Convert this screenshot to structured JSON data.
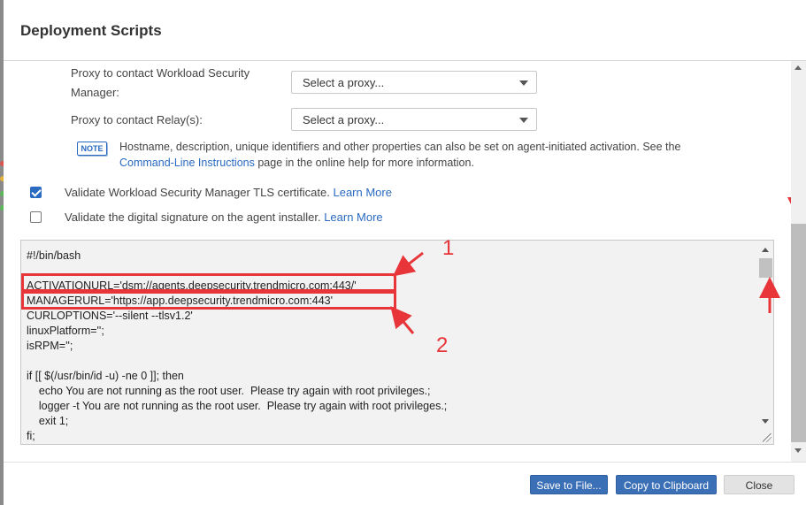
{
  "dialog": {
    "title": "Deployment Scripts"
  },
  "proxy_manager": {
    "label_line1": "Proxy to contact Workload Security",
    "label_line2": "Manager:",
    "value": "Select a proxy..."
  },
  "proxy_relay": {
    "label": "Proxy to contact Relay(s):",
    "value": "Select a proxy..."
  },
  "note": {
    "badge": "NOTE",
    "text_part1": "Hostname, description, unique identifiers and other properties can also be set on agent-initiated activation. See the",
    "link": "Command-Line Instructions",
    "text_part2": " page in the online help for more information."
  },
  "validate_tls": {
    "label": "Validate Workload Security Manager TLS certificate. ",
    "link": "Learn More",
    "checked": true
  },
  "validate_signature": {
    "label": "Validate the digital signature on the agent installer. ",
    "link": "Learn More",
    "checked": false
  },
  "script": {
    "lines": [
      "#!/bin/bash",
      "",
      "ACTIVATIONURL='dsm://agents.deepsecurity.trendmicro.com:443/'",
      "MANAGERURL='https://app.deepsecurity.trendmicro.com:443'",
      "CURLOPTIONS='--silent --tlsv1.2'",
      "linuxPlatform='';",
      "isRPM='';",
      "",
      "if [[ $(/usr/bin/id -u) -ne 0 ]]; then",
      "    echo You are not running as the root user.  Please try again with root privileges.;",
      "    logger -t You are not running as the root user.  Please try again with root privileges.;",
      "    exit 1;",
      "fi;"
    ]
  },
  "annotations": {
    "num1": "1",
    "num2": "2",
    "color": "#e8353a"
  },
  "footer": {
    "save_label": "Save to File...",
    "copy_label": "Copy to Clipboard",
    "close_label": "Close"
  }
}
